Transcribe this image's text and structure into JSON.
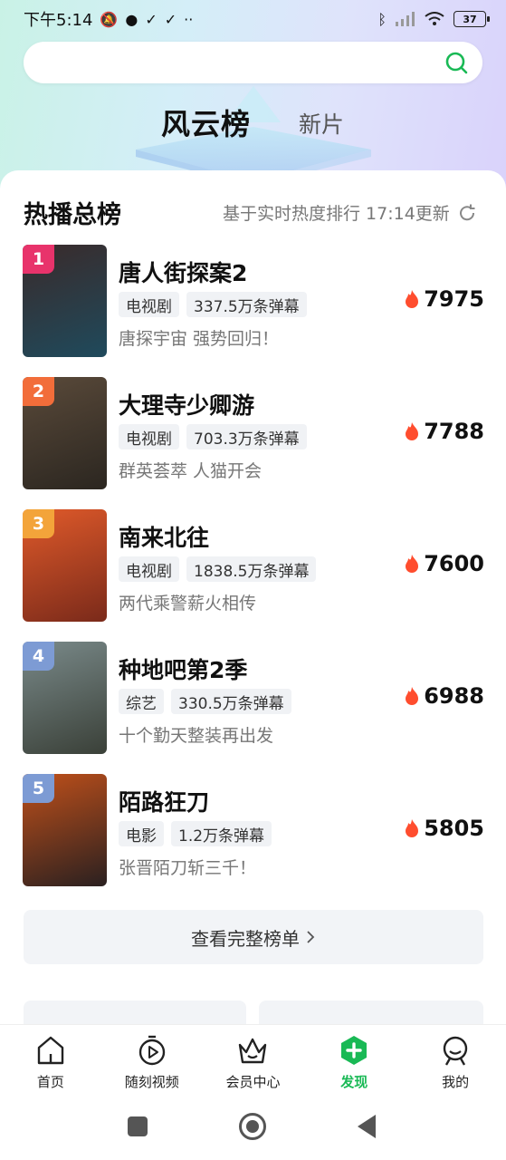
{
  "status_bar": {
    "time": "下午5:14",
    "left_icons": [
      "mute-icon",
      "chat-icon",
      "check-icon",
      "check-icon",
      "more-dots-icon"
    ],
    "right_icons": [
      "bluetooth-icon",
      "signal-icon",
      "wifi-icon"
    ],
    "battery": "37"
  },
  "search": {
    "placeholder": ""
  },
  "header_tabs": {
    "active": "风云榜",
    "inactive": "新片"
  },
  "section": {
    "title": "热播总榜",
    "meta": "基于实时热度排行 17:14更新"
  },
  "items": [
    {
      "rank": "1",
      "rank_color": "#e8336b",
      "title": "唐人街探案2",
      "tags": [
        "电视剧",
        "337.5万条弹幕"
      ],
      "desc": "唐探宇宙 强势回归！",
      "score": "7975",
      "poster_colors": [
        "#3a2a2a",
        "#1f4a5c"
      ]
    },
    {
      "rank": "2",
      "rank_color": "#f26d3a",
      "title": "大理寺少卿游",
      "tags": [
        "电视剧",
        "703.3万条弹幕"
      ],
      "desc": "群英荟萃 人猫开会",
      "score": "7788",
      "poster_colors": [
        "#5a4a3a",
        "#2b2620"
      ]
    },
    {
      "rank": "3",
      "rank_color": "#f3a43a",
      "title": "南来北往",
      "tags": [
        "电视剧",
        "1838.5万条弹幕"
      ],
      "desc": "两代乘警薪火相传",
      "score": "7600",
      "poster_colors": [
        "#e05a2a",
        "#7a2a1a"
      ]
    },
    {
      "rank": "4",
      "rank_color": "#7d9bd4",
      "title": "种地吧第2季",
      "tags": [
        "综艺",
        "330.5万条弹幕"
      ],
      "desc": "十个勤天整装再出发",
      "score": "6988",
      "poster_colors": [
        "#7a8a8a",
        "#3a4038"
      ]
    },
    {
      "rank": "5",
      "rank_color": "#7d9bd4",
      "title": "陌路狂刀",
      "tags": [
        "电影",
        "1.2万条弹幕"
      ],
      "desc": "张晋陌刀斩三千！",
      "score": "5805",
      "poster_colors": [
        "#c0501a",
        "#2a2020"
      ]
    }
  ],
  "full_list_label": "查看完整榜单",
  "bottom_nav": [
    {
      "label": "首页",
      "icon": "home-icon",
      "active": false
    },
    {
      "label": "随刻视频",
      "icon": "play-circle-icon",
      "active": false
    },
    {
      "label": "会员中心",
      "icon": "crown-icon",
      "active": false
    },
    {
      "label": "发现",
      "icon": "discover-plus-icon",
      "active": true
    },
    {
      "label": "我的",
      "icon": "profile-icon",
      "active": false
    }
  ],
  "colors": {
    "accent": "#19b955",
    "fire": "#ff4d2e"
  }
}
